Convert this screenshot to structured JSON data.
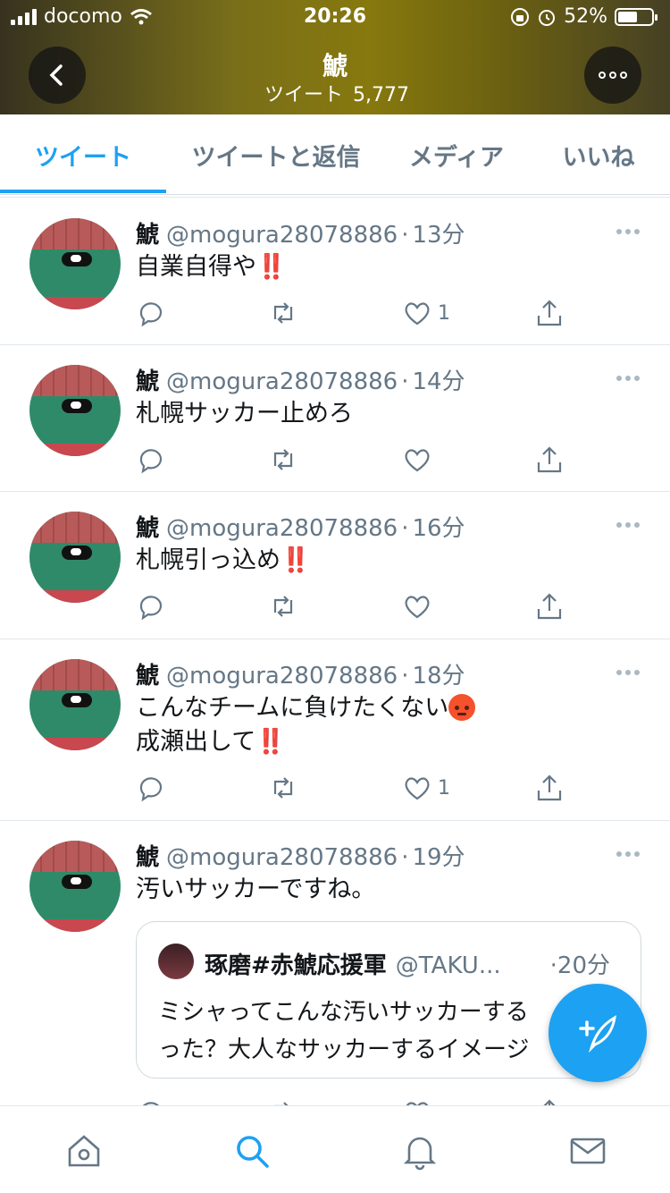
{
  "status_bar": {
    "carrier": "docomo",
    "time": "20:26",
    "battery": "52%"
  },
  "header": {
    "title": "鯱",
    "subtitle_label": "ツイート",
    "tweet_count": "5,777"
  },
  "tabs": [
    {
      "label": "ツイート",
      "active": true
    },
    {
      "label": "ツイートと返信",
      "active": false
    },
    {
      "label": "メディア",
      "active": false
    },
    {
      "label": "いいね",
      "active": false
    }
  ],
  "tweets": [
    {
      "name": "鯱",
      "handle": "@mogura28078886",
      "sep": "·",
      "time": "13分",
      "text": "自業自得や",
      "bang": "‼️",
      "likes": "1"
    },
    {
      "name": "鯱",
      "handle": "@mogura28078886",
      "sep": "·",
      "time": "14分",
      "text": "札幌サッカー止めろ",
      "likes": ""
    },
    {
      "name": "鯱",
      "handle": "@mogura28078886",
      "sep": "·",
      "time": "16分",
      "text": "札幌引っ込め",
      "bang": "‼️",
      "likes": ""
    },
    {
      "name": "鯱",
      "handle": "@mogura28078886",
      "sep": "·",
      "time": "18分",
      "text_line1": "こんなチームに負けたくない",
      "text_line2": "成瀬出して",
      "bang": "‼️",
      "likes": "1"
    },
    {
      "name": "鯱",
      "handle": "@mogura28078886",
      "sep": "·",
      "time": "19分",
      "text": "汚いサッカーですね。",
      "quote": {
        "name": "琢磨#赤鯱応援軍",
        "handle": "@TAKU...",
        "sep": "·",
        "time": "20分",
        "line1": "ミシャってこんな汚いサッカーする",
        "line2": "った？大人なサッカーするイメージ"
      }
    }
  ],
  "icons": {
    "reply": "reply-icon",
    "retweet": "retweet-icon",
    "like": "heart-icon",
    "share": "share-icon",
    "home": "home-icon",
    "search": "search-icon",
    "notifications": "bell-icon",
    "messages": "mail-icon",
    "compose": "compose-icon"
  },
  "colors": {
    "accent": "#1da1f2",
    "secondary_text": "#657786",
    "alert": "#e0245e"
  }
}
